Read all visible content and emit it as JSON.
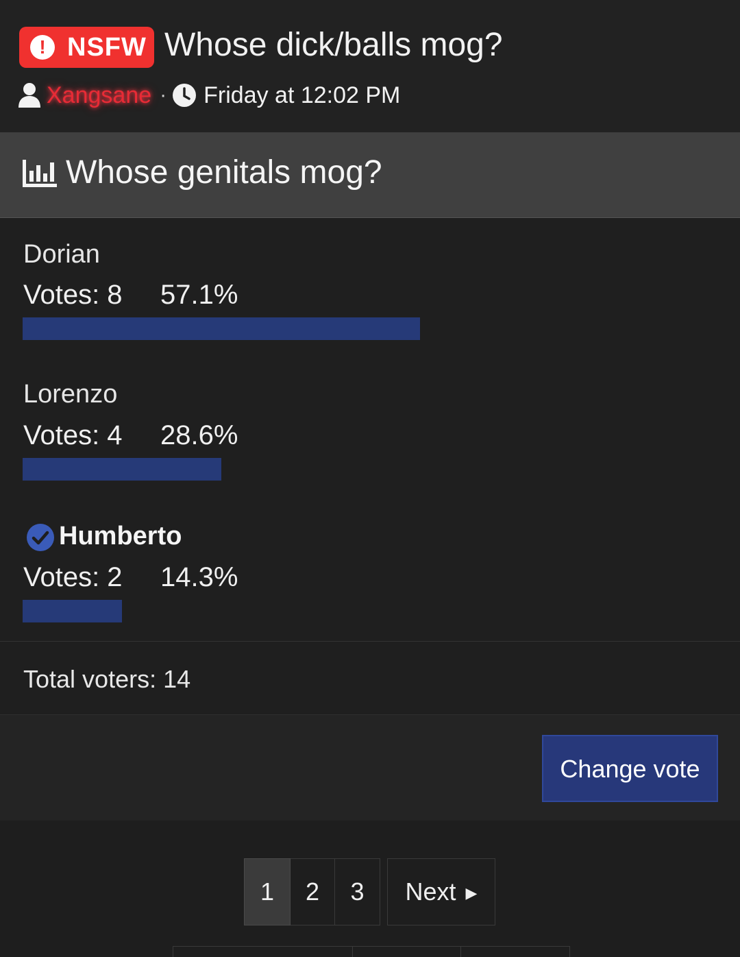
{
  "thread": {
    "badge": "NSFW",
    "title": "Whose dick/balls mog?",
    "author": "Xangsane",
    "separator": "·",
    "date": "Friday at 12:02 PM"
  },
  "poll": {
    "title": "Whose genitals mog?",
    "options": [
      {
        "name": "Dorian",
        "votes_label": "Votes: 8",
        "percent_label": "57.1%",
        "votes": 8,
        "percent": 57.1,
        "voted": false
      },
      {
        "name": "Lorenzo",
        "votes_label": "Votes: 4",
        "percent_label": "28.6%",
        "votes": 4,
        "percent": 28.6,
        "voted": false
      },
      {
        "name": "Humberto",
        "votes_label": "Votes: 2",
        "percent_label": "14.3%",
        "votes": 2,
        "percent": 14.3,
        "voted": true
      }
    ],
    "total_voters": "Total voters: 14",
    "change_vote_label": "Change vote"
  },
  "pagination": {
    "pages": [
      "1",
      "2",
      "3"
    ],
    "current": "1",
    "next_label": "Next"
  },
  "colors": {
    "nsfw_red": "#f0312f",
    "bar_fill": "#263a78",
    "button_blue": "#27387a",
    "username_red": "#e82b36"
  },
  "icons": [
    "exclamation-circle-icon",
    "user-icon",
    "clock-icon",
    "bar-chart-icon",
    "check-circle-icon",
    "caret-right-icon"
  ]
}
